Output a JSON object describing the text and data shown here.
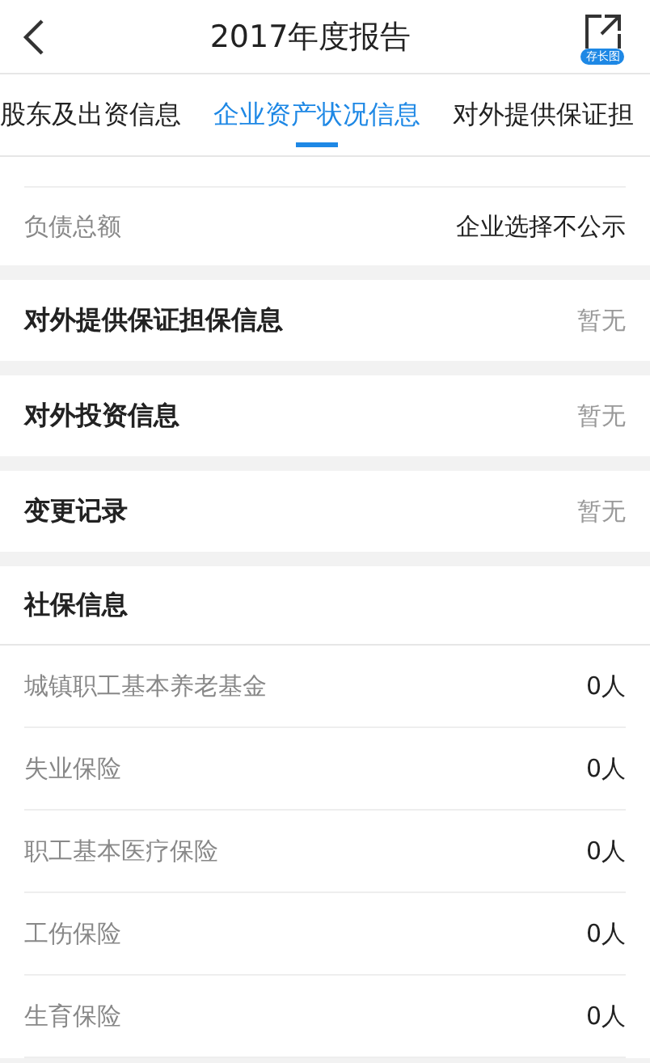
{
  "header": {
    "title": "2017年度报告",
    "save_badge": "存长图"
  },
  "tabs": [
    {
      "label": "股东及出资信息",
      "selected": false
    },
    {
      "label": "企业资产状况信息",
      "selected": true
    },
    {
      "label": "对外提供保证担",
      "selected": false
    }
  ],
  "asset_rows": [
    {
      "label": "负债总额",
      "value": "企业选择不公示"
    }
  ],
  "sections": [
    {
      "title": "对外提供保证担保信息",
      "value": "暂无"
    },
    {
      "title": "对外投资信息",
      "value": "暂无"
    },
    {
      "title": "变更记录",
      "value": "暂无"
    }
  ],
  "social_insurance": {
    "title": "社保信息",
    "rows": [
      {
        "label": "城镇职工基本养老基金",
        "value": "0人"
      },
      {
        "label": "失业保险",
        "value": "0人"
      },
      {
        "label": "职工基本医疗保险",
        "value": "0人"
      },
      {
        "label": "工伤保险",
        "value": "0人"
      },
      {
        "label": "生育保险",
        "value": "0人"
      }
    ]
  }
}
